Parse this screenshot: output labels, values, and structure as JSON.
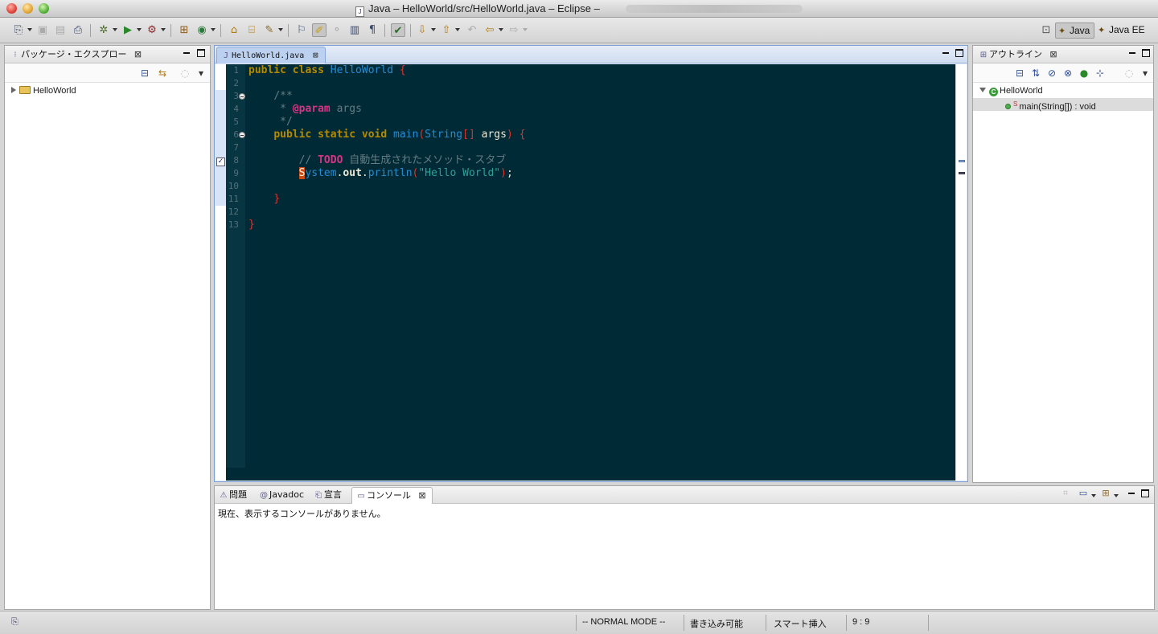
{
  "window": {
    "title": "Java – HelloWorld/src/HelloWorld.java – Eclipse –"
  },
  "perspectives": [
    {
      "label": "Java",
      "active": true
    },
    {
      "label": "Java EE",
      "active": false
    }
  ],
  "package_explorer": {
    "tab_label": "パッケージ・エクスプロー",
    "tree": [
      {
        "label": "HelloWorld",
        "expanded": false
      }
    ]
  },
  "editor": {
    "tab_label": "HelloWorld.java",
    "line_numbers": [
      "1",
      "2",
      "3",
      "4",
      "5",
      "6",
      "7",
      "8",
      "9",
      "10",
      "11",
      "12",
      "13"
    ],
    "code": {
      "l1_kw": "public class",
      "l1_name": "HelloWorld",
      "l1_brace": "{",
      "l3": "/**",
      "l4_star": " * ",
      "l4_tag": "@param",
      "l4_rest": " args",
      "l5": " */",
      "l6_kw": "public static void",
      "l6_method": "main",
      "l6_paren_open": "(",
      "l6_type": "String",
      "l6_arr": "[]",
      "l6_arg": " args",
      "l6_paren_close": ")",
      "l6_brace": "{",
      "l8_slash": "// ",
      "l8_todo": "TODO",
      "l8_rest": " 自動生成されたメソッド・スタブ",
      "l9_caret": "S",
      "l9_sys": "ystem",
      "l9_dot1": ".",
      "l9_out": "out",
      "l9_dot2": ".",
      "l9_println": "println",
      "l9_po": "(",
      "l9_str": "\"Hello World\"",
      "l9_pc": ")",
      "l9_semi": ";",
      "l11": "}",
      "l13": "}"
    },
    "theme": {
      "background": "#002b36",
      "keyword": "#b58900",
      "string": "#2aa198",
      "bracket": "#dc322f"
    }
  },
  "outline": {
    "tab_label": "アウトライン",
    "items": [
      {
        "label": "HelloWorld",
        "icon": "class-icon"
      },
      {
        "label": "main(String[]) : void",
        "icon": "public-method-icon",
        "modifier": "S"
      }
    ]
  },
  "bottom_panel": {
    "tabs": [
      {
        "label": "問題",
        "icon": "problems-icon"
      },
      {
        "label": "Javadoc",
        "icon": "at-icon"
      },
      {
        "label": "宣言",
        "icon": "declaration-icon"
      },
      {
        "label": "コンソール",
        "icon": "console-icon",
        "active": true
      }
    ],
    "console_message": "現在、表示するコンソールがありません。"
  },
  "status_bar": {
    "mode": "-- NORMAL MODE --",
    "writable": "書き込み可能",
    "insert_mode": "スマート挿入",
    "position": "9 : 9"
  }
}
